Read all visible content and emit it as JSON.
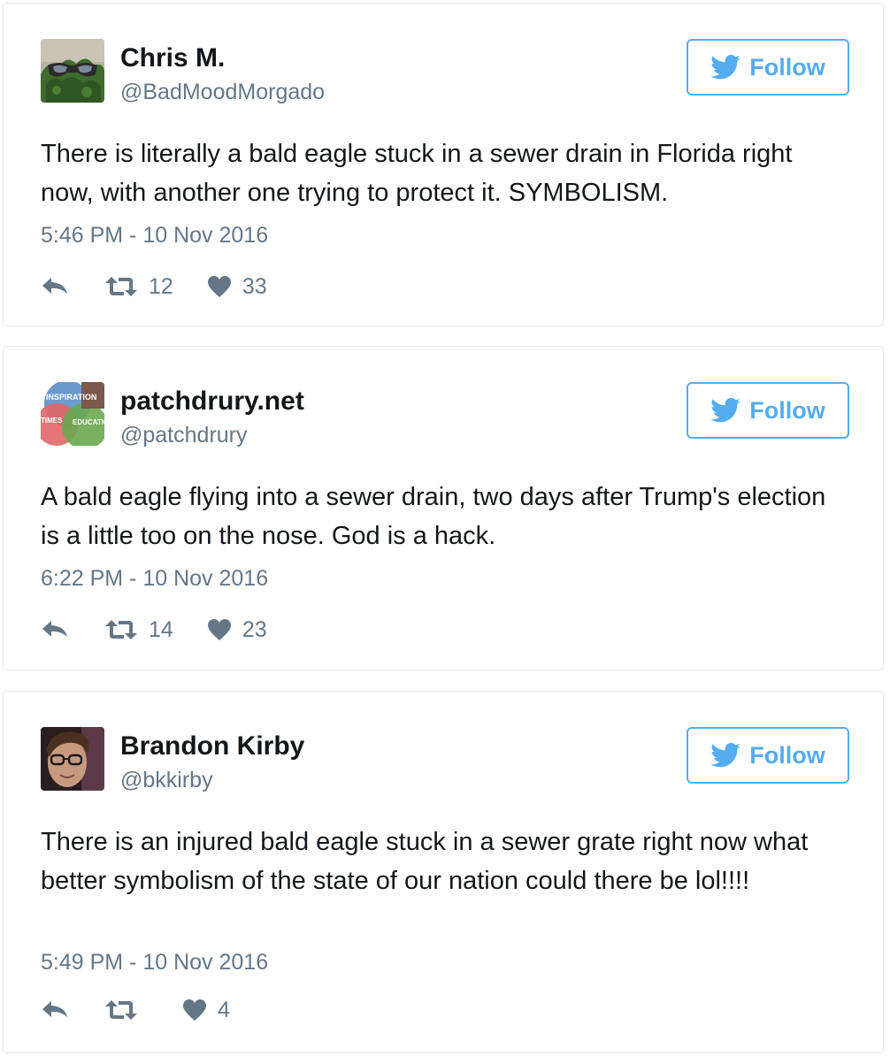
{
  "colors": {
    "accent": "#55acee",
    "text": "#14171a",
    "muted": "#657786",
    "border": "#e1e8ed"
  },
  "tweets": [
    {
      "display_name": "Chris M.",
      "screen_name": "@BadMoodMorgado",
      "avatar_icon": "sunglasses-plant-avatar",
      "follow_label": "Follow",
      "text": "There is literally a bald eagle stuck in a sewer drain in Florida right now, with another one trying to protect it. SYMBOLISM.",
      "timestamp": "5:46 PM - 10 Nov 2016",
      "retweets": "12",
      "likes": "33"
    },
    {
      "display_name": "patchdrury.net",
      "screen_name": "@patchdrury",
      "avatar_icon": "inspiration-education-avatar",
      "avatar_text": [
        "INSPIRATION",
        "TIMES",
        "EDUCATION"
      ],
      "follow_label": "Follow",
      "text": "A bald eagle flying into a sewer drain, two days after Trump's election is a little too on the nose. God is a hack.",
      "timestamp": "6:22 PM - 10 Nov 2016",
      "retweets": "14",
      "likes": "23"
    },
    {
      "display_name": "Brandon Kirby",
      "screen_name": "@bkkirby",
      "avatar_icon": "glasses-portrait-avatar",
      "follow_label": "Follow",
      "text": "There is an injured bald eagle stuck in a sewer grate right now what better symbolism of the state of our nation could there be lol!!!!",
      "timestamp": "5:49 PM - 10 Nov 2016",
      "retweets": "",
      "likes": "4"
    }
  ]
}
